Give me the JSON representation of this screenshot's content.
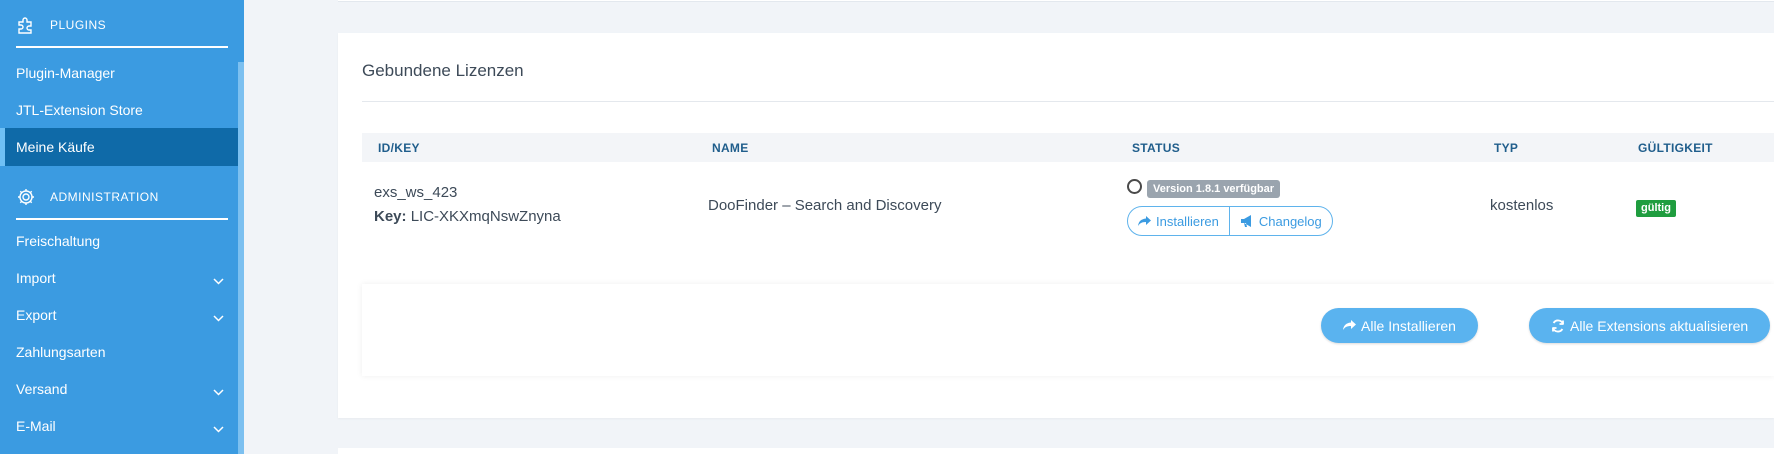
{
  "sidebar": {
    "sections": [
      {
        "label": "PLUGINS",
        "icon": "puzzle-icon"
      },
      {
        "label": "ADMINISTRATION",
        "icon": "gear-icon"
      }
    ],
    "plugin_items": [
      {
        "label": "Plugin-Manager"
      },
      {
        "label": "JTL-Extension Store"
      },
      {
        "label": "Meine Käufe",
        "active": true
      }
    ],
    "admin_items": [
      {
        "label": "Freischaltung",
        "has_submenu": false
      },
      {
        "label": "Import",
        "has_submenu": true
      },
      {
        "label": "Export",
        "has_submenu": true
      },
      {
        "label": "Zahlungsarten",
        "has_submenu": false
      },
      {
        "label": "Versand",
        "has_submenu": true
      },
      {
        "label": "E-Mail",
        "has_submenu": true
      }
    ]
  },
  "licenses": {
    "title": "Gebundene Lizenzen",
    "columns": [
      "ID/KEY",
      "NAME",
      "STATUS",
      "TYP",
      "GÜLTIGKEIT"
    ],
    "rows": [
      {
        "id": "exs_ws_423",
        "key_label": "Key:",
        "key": "LIC-XKXmqNswZnyna",
        "name": "DooFinder – Search and Discovery",
        "version_badge": "Version 1.8.1 verfügbar",
        "install_label": "Installieren",
        "changelog_label": "Changelog",
        "type": "kostenlos",
        "validity": "gültig"
      }
    ],
    "install_all_label": "Alle Installieren",
    "update_all_label": "Alle Extensions aktualisieren"
  },
  "colors": {
    "sidebar_bg": "#3b9be1",
    "sidebar_active": "#0f6aa8",
    "accent": "#5ab3ef",
    "header_text": "#205e8c",
    "valid_green": "#1f9d3f",
    "badge_gray": "#9aa4ae"
  }
}
